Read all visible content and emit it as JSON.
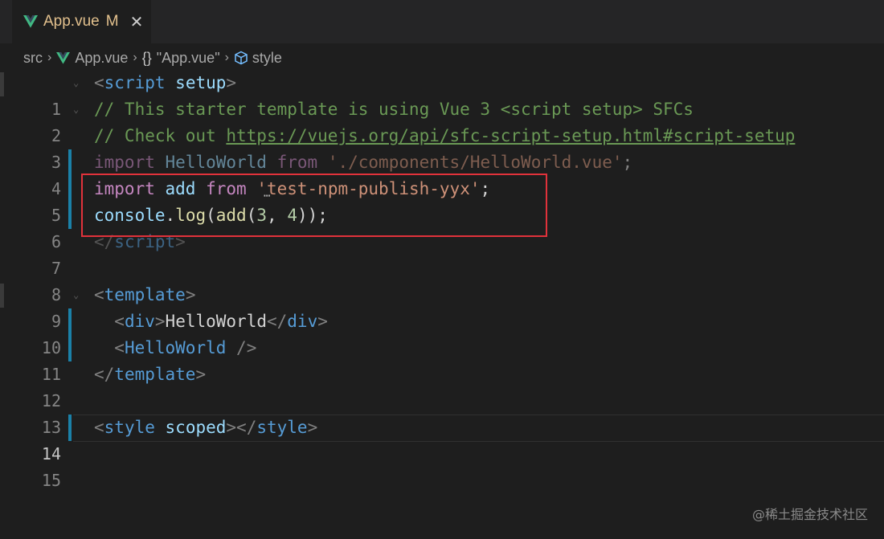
{
  "tab": {
    "filename": "App.vue",
    "modified_marker": "M",
    "close_glyph": "✕",
    "logo_icon": "vue-logo-icon"
  },
  "breadcrumb": {
    "items": [
      "src",
      "App.vue",
      "\"App.vue\"",
      "style"
    ],
    "separator": "›",
    "braces_glyph": "{}"
  },
  "editor": {
    "line_numbers": [
      "1",
      "2",
      "3",
      "4",
      "5",
      "6",
      "7",
      "8",
      "9",
      "10",
      "11",
      "12",
      "13",
      "14",
      "15"
    ],
    "active_line": "14",
    "lines": {
      "l1": {
        "lt": "<",
        "tag": "script",
        "attr": "setup",
        "gt": ">"
      },
      "l2": {
        "comment": "// This starter template is using Vue 3 <script setup> SFCs"
      },
      "l3": {
        "comment": "// Check out ",
        "link": "https://vuejs.org/api/sfc-script-setup.html#script-setup"
      },
      "l4": {
        "import": "import",
        "ident": "HelloWorld",
        "from": "from",
        "string": "'./components/HelloWorld.vue'",
        "semi": ";"
      },
      "l5": {
        "import": "import",
        "ident": "add",
        "from": "from",
        "string": "'test-npm-publish-yyx'",
        "semi": ";"
      },
      "l6": {
        "obj": "console",
        "dot": ".",
        "method": "log",
        "open": "(",
        "fn": "add",
        "open2": "(",
        "n1": "3",
        "comma": ", ",
        "n2": "4",
        "close": "));"
      },
      "l7": {
        "lt": "</",
        "tag": "script",
        "gt": ">"
      },
      "l9": {
        "lt": "<",
        "tag": "template",
        "gt": ">"
      },
      "l10": {
        "indent": "  ",
        "lt": "<",
        "tag": "div",
        "gt": ">",
        "text": "HelloWorld",
        "lt2": "</",
        "tag2": "div",
        "gt2": ">"
      },
      "l11": {
        "indent": "  ",
        "lt": "<",
        "tag": "HelloWorld",
        "space": " ",
        "gt": "/>"
      },
      "l12": {
        "lt": "</",
        "tag": "template",
        "gt": ">"
      },
      "l14": {
        "lt": "<",
        "tag": "style",
        "attr": "scoped",
        "gt": ">",
        "lt2": "</",
        "tag2": "style",
        "gt2": ">"
      }
    },
    "hint_dots": "⋯"
  },
  "watermark": "@稀土掘金技术社区",
  "colors": {
    "background": "#1e1e1e",
    "tabbar": "#252526",
    "tab_text": "#e2c08d",
    "highlight_border": "#e1323b",
    "vue_green": "#41b883",
    "git_modified": "#1b81a8"
  }
}
